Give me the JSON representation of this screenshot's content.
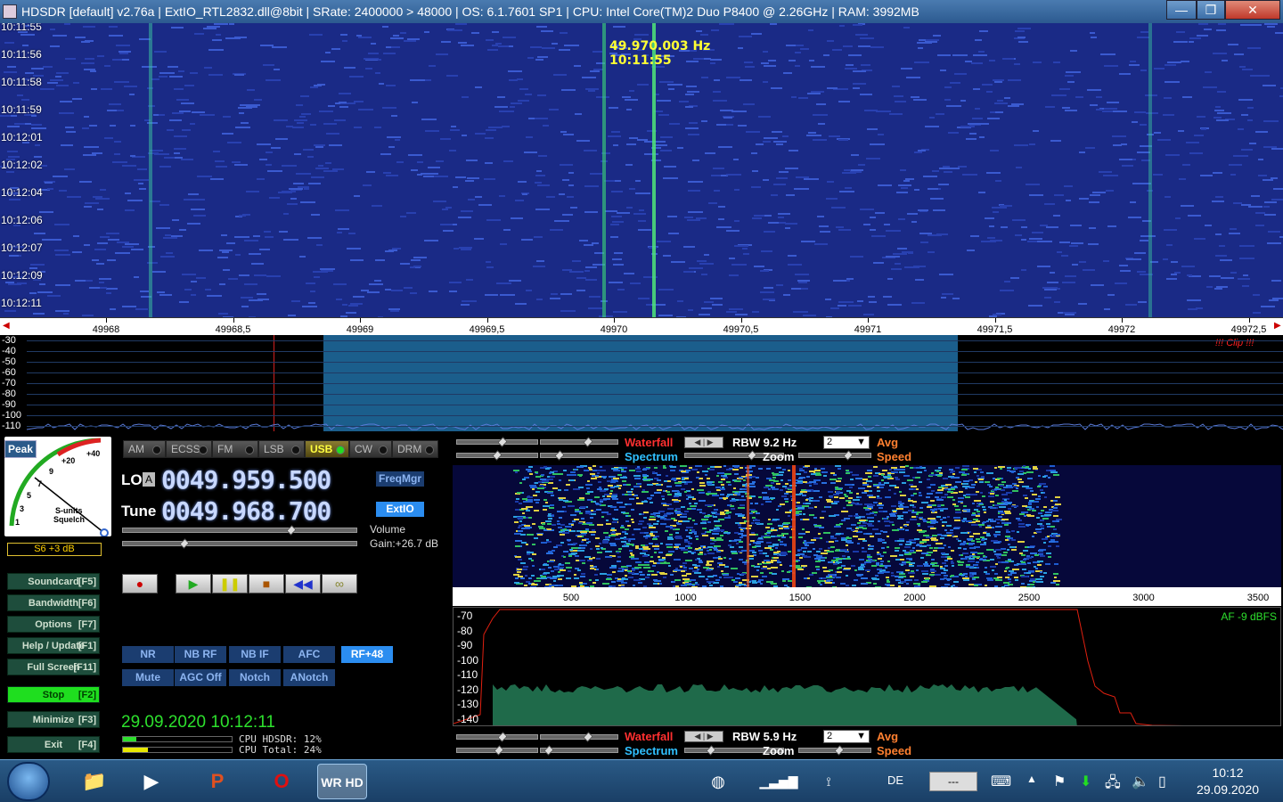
{
  "titlebar": {
    "title": "HDSDR  [default]  v2.76a  |  ExtIO_RTL2832.dll@8bit  |  SRate: 2400000 > 48000  |  OS: 6.1.7601 SP1  |  CPU: Intel Core(TM)2 Duo      P8400  @ 2.26GHz  |  RAM: 3992MB",
    "minimize": "—",
    "maximize": "❐",
    "close": "✕"
  },
  "waterfall": {
    "timestamps": [
      "10:11:55",
      "10:11:56",
      "10:11:58",
      "10:11:59",
      "10:12:01",
      "10:12:02",
      "10:12:04",
      "10:12:06",
      "10:12:07",
      "10:12:09",
      "10:12:11"
    ],
    "marker_freq": "49.970.003 Hz",
    "marker_time": "10:11:55"
  },
  "freq_axis": {
    "labels": [
      "49968",
      "49968,5",
      "49969",
      "49969,5",
      "49970",
      "49970,5",
      "49971",
      "49971,5",
      "49972",
      "49972,5"
    ]
  },
  "spectrum": {
    "db_labels": [
      "-30",
      "-40",
      "-50",
      "-60",
      "-70",
      "-80",
      "-90",
      "-100",
      "-110"
    ],
    "clip": "!!! Clip !!!"
  },
  "smeter": {
    "peak": "Peak",
    "scale_labels": [
      "+40",
      "+20",
      "9",
      "7",
      "5",
      "3",
      "1"
    ],
    "caption1": "S-units",
    "caption2": "Squelch",
    "value": "S6 +3 dB"
  },
  "modes": [
    {
      "label": "AM",
      "active": false
    },
    {
      "label": "ECSS",
      "active": false
    },
    {
      "label": "FM",
      "active": false
    },
    {
      "label": "LSB",
      "active": false
    },
    {
      "label": "USB",
      "active": true
    },
    {
      "label": "CW",
      "active": false
    },
    {
      "label": "DRM",
      "active": false
    }
  ],
  "lo": {
    "label": "LO",
    "lock": "A",
    "value": "0049.959.500"
  },
  "tune": {
    "label": "Tune",
    "value": "0049.968.700"
  },
  "buttons": {
    "freqmgr": "FreqMgr",
    "extio": "ExtIO"
  },
  "volume": {
    "label": "Volume",
    "gain": "Gain:+26.7 dB"
  },
  "side": {
    "soundcard": "Soundcard",
    "soundcard_key": "[F5]",
    "bandwidth": "Bandwidth",
    "bandwidth_key": "[F6]",
    "options": "Options",
    "options_key": "[F7]",
    "help": "Help / Update",
    "help_key": "[F1]",
    "fullscreen": "Full Screen",
    "fullscreen_key": "[F11]",
    "stop": "Stop",
    "stop_key": "[F2]",
    "minimize": "Minimize",
    "minimize_key": "[F3]",
    "exit": "Exit",
    "exit_key": "[F4]"
  },
  "recorder": {
    "record": "●",
    "play": "▶",
    "pause": "❚❚",
    "stop": "■",
    "rewind": "◀◀",
    "loop": "∞"
  },
  "dsp": {
    "nr": "NR",
    "nbrf": "NB RF",
    "nbif": "NB IF",
    "afc": "AFC",
    "rf": "RF+48",
    "mute": "Mute",
    "agc": "AGC Off",
    "notch": "Notch",
    "anotch": "ANotch"
  },
  "status": {
    "datetime": "29.09.2020 10:12:11",
    "cpu_hdsdr": "CPU HDSDR: 12%",
    "cpu_total": "CPU Total: 24%",
    "cpu_hdsdr_level": 0.12,
    "cpu_total_level": 0.24
  },
  "af_top": {
    "waterfall": "Waterfall",
    "spectrum": "Spectrum",
    "rbw": "RBW  9.2 Hz",
    "zoom": "Zoom",
    "combo": "2",
    "avg": "Avg",
    "speed": "Speed"
  },
  "af_axis": {
    "labels": [
      "500",
      "1000",
      "1500",
      "2000",
      "2500",
      "3000",
      "3500"
    ]
  },
  "af_spectrum": {
    "db_labels": [
      "-70",
      "-80",
      "-90",
      "-100",
      "-110",
      "-120",
      "-130",
      "-140"
    ],
    "level": "AF  -9 dBFS"
  },
  "af_bottom": {
    "waterfall": "Waterfall",
    "spectrum": "Spectrum",
    "rbw": "RBW  5.9 Hz",
    "zoom": "Zoom",
    "combo": "2",
    "avg": "Avg",
    "speed": "Speed"
  },
  "taskbar": {
    "lang": "DE",
    "time": "10:12",
    "date": "29.09.2020",
    "tray_box": "---"
  },
  "colors": {
    "waterfall_bg": "#1a2a86",
    "accent_green": "#2de02d",
    "marker_yellow": "#ffff33",
    "clip_red": "#ff2020"
  }
}
